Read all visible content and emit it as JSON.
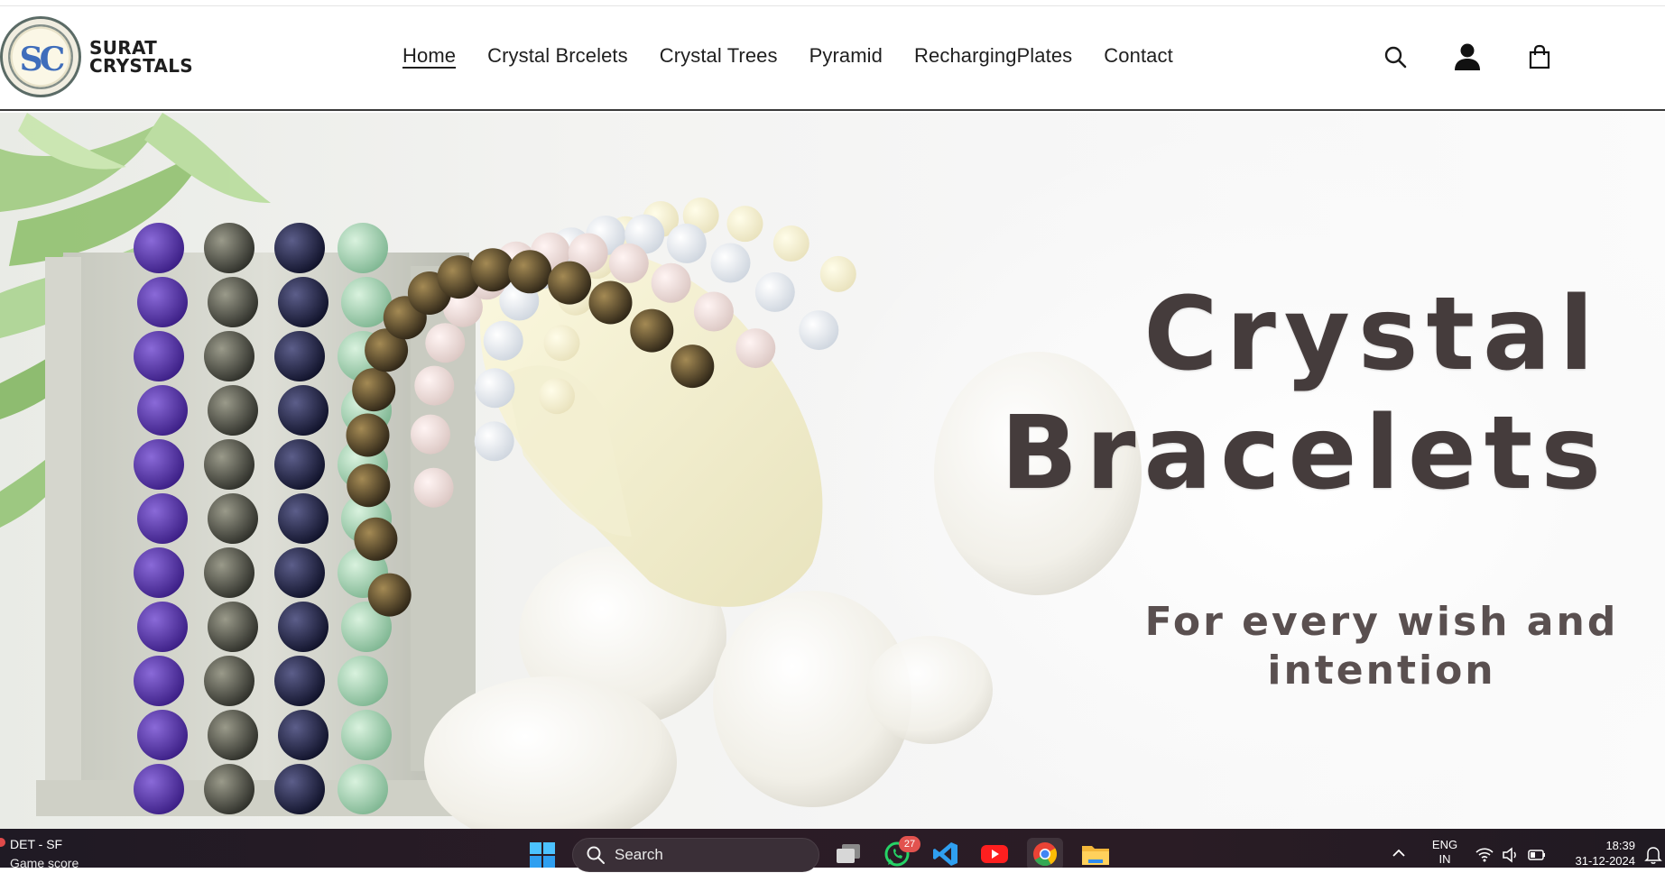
{
  "brand": {
    "name_line1": "SURAT",
    "name_line2": "CRYSTALS",
    "monogram": "SC"
  },
  "nav": {
    "items": [
      {
        "label": "Home",
        "active": true
      },
      {
        "label": "Crystal Brcelets",
        "active": false
      },
      {
        "label": "Crystal Trees",
        "active": false
      },
      {
        "label": "Pyramid",
        "active": false
      },
      {
        "label": "RechargingPlates",
        "active": false
      },
      {
        "label": "Contact",
        "active": false
      }
    ]
  },
  "header_icons": [
    "search-icon",
    "user-icon",
    "shopping-bag-icon"
  ],
  "hero": {
    "title_line1": "Crystal",
    "title_line2": "Bracelets",
    "subtitle_line1": "For every wish and",
    "subtitle_line2": "intention"
  },
  "taskbar": {
    "widget_title": "DET - SF",
    "widget_subtitle": "Game score",
    "search_label": "Search",
    "whatsapp_badge": "27",
    "lang_line1": "ENG",
    "lang_line2": "IN",
    "time": "18:39",
    "date": "31-12-2024",
    "apps": [
      "windows-start-icon",
      "task-view-icon",
      "whatsapp-icon",
      "vscode-icon",
      "youtube-icon",
      "chrome-icon",
      "file-explorer-icon"
    ]
  },
  "colors": {
    "nav_text": "#1f1f1f",
    "hero_title": "#453c3c",
    "taskbar_bg": "#2b1c26"
  }
}
